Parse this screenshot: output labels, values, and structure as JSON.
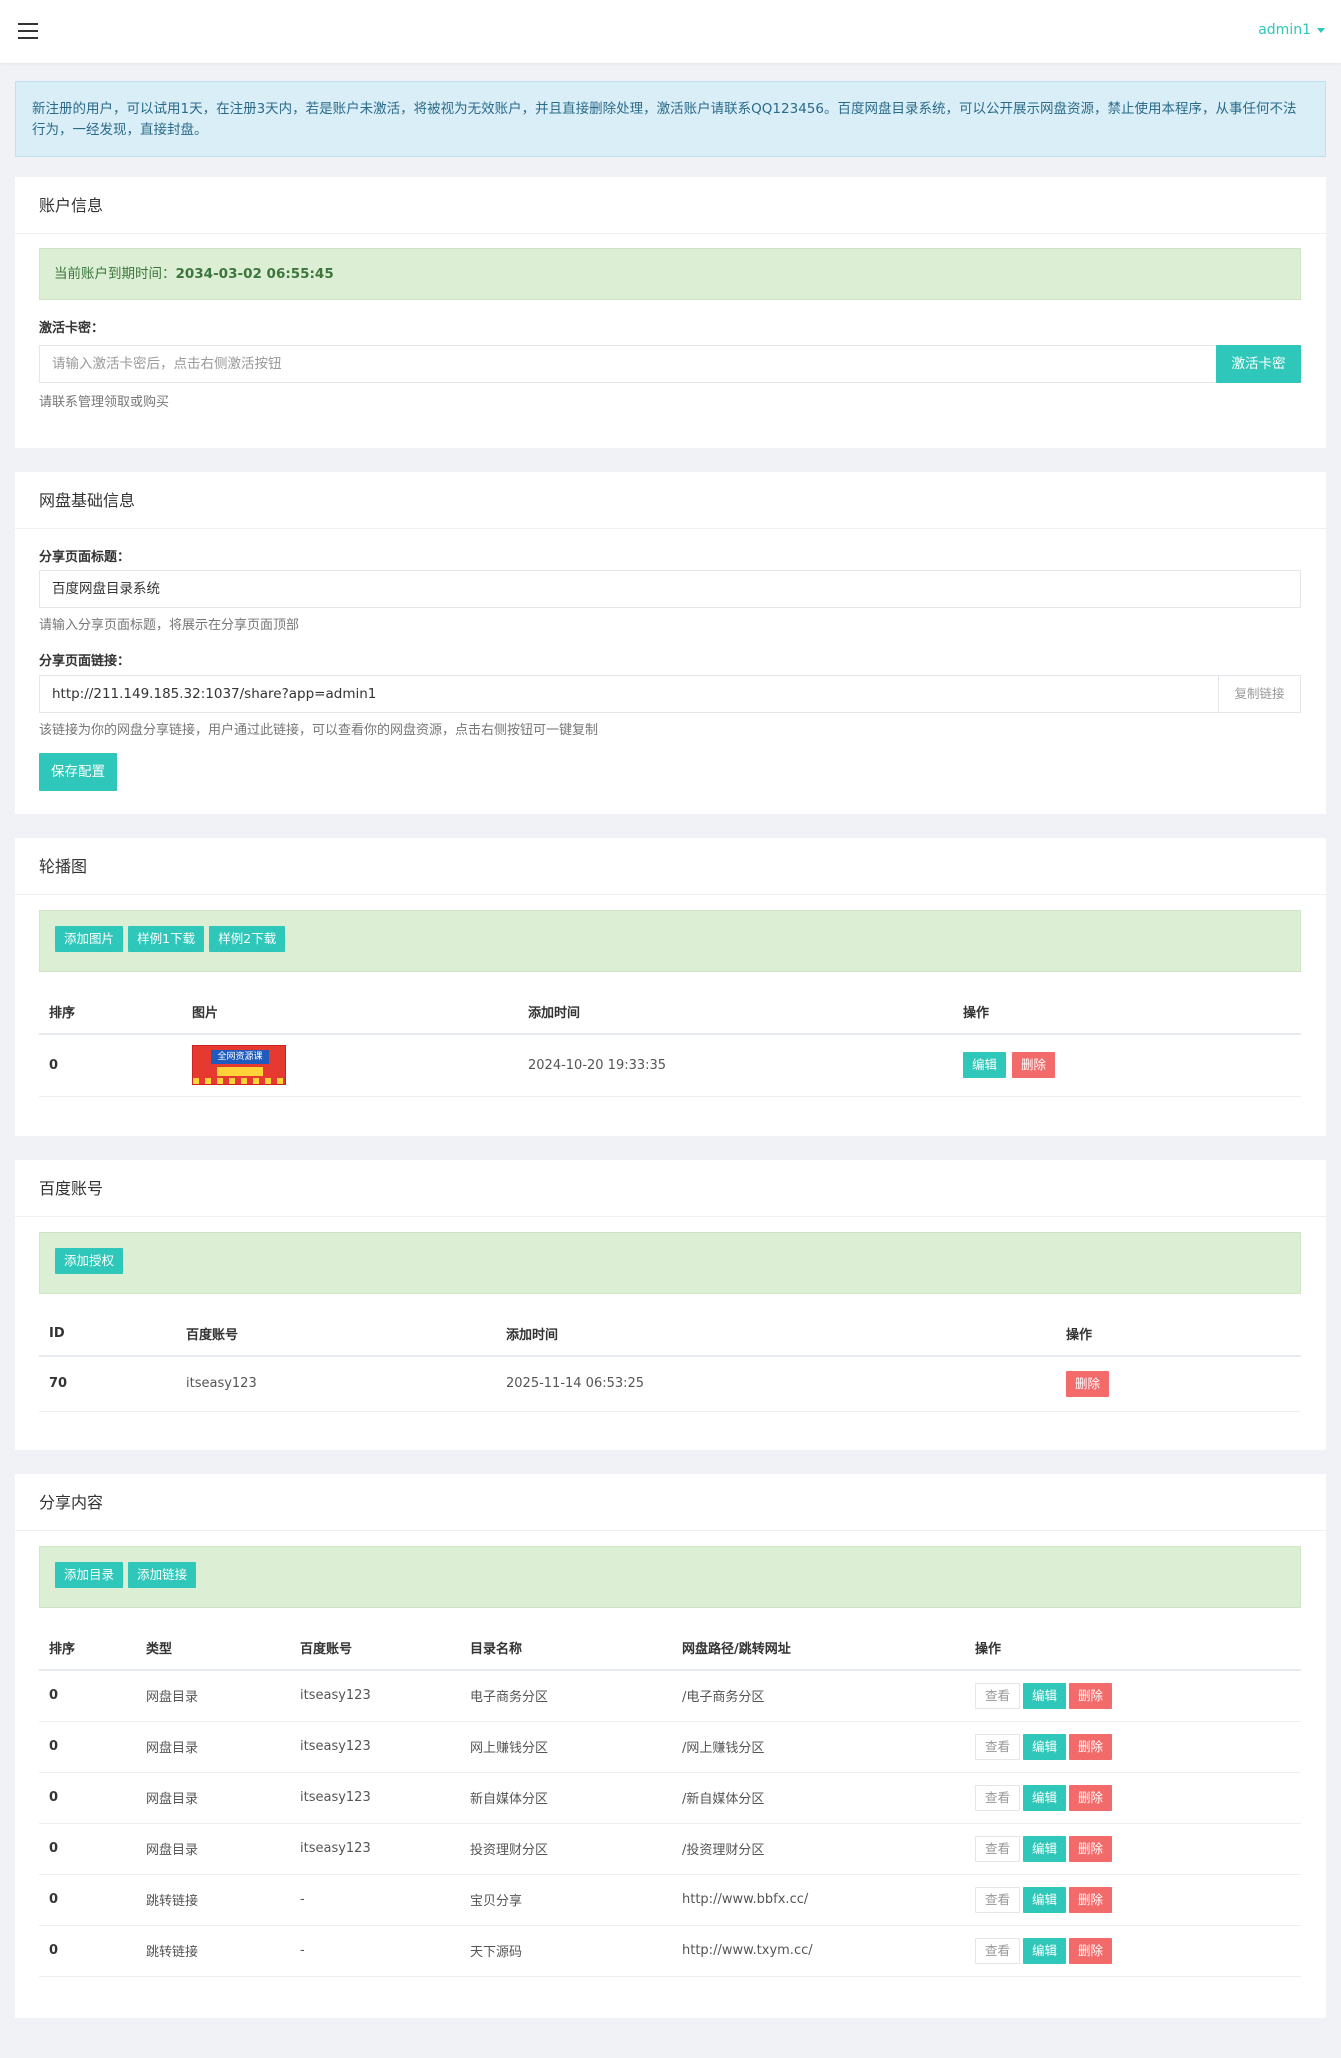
{
  "header": {
    "user": "admin1"
  },
  "notice": "新注册的用户，可以试用1天，在注册3天内，若是账户未激活，将被视为无效账户，并且直接删除处理，激活账户请联系QQ123456。百度网盘目录系统，可以公开展示网盘资源，禁止使用本程序，从事任何不法行为，一经发现，直接封盘。",
  "account": {
    "title": "账户信息",
    "expiry_label": "当前账户到期时间：",
    "expiry_value": "2034-03-02 06:55:45",
    "card_label": "激活卡密：",
    "card_placeholder": "请输入激活卡密后，点击右侧激活按钮",
    "activate_button": "激活卡密",
    "help": "请联系管理领取或购买"
  },
  "basic": {
    "title": "网盘基础信息",
    "share_title_label": "分享页面标题：",
    "share_title_value": "百度网盘目录系统",
    "share_title_help": "请输入分享页面标题，将展示在分享页面顶部",
    "share_link_label": "分享页面链接：",
    "share_link_value": "http://211.149.185.32:1037/share?app=admin1",
    "copy_button": "复制链接",
    "share_link_help": "该链接为你的网盘分享链接，用户通过此链接，可以查看你的网盘资源，点击右侧按钮可一键复制",
    "save_button": "保存配置"
  },
  "carousel": {
    "title": "轮播图",
    "buttons": [
      "添加图片",
      "样例1下载",
      "样例2下载"
    ],
    "columns": [
      "排序",
      "图片",
      "添加时间",
      "操作"
    ],
    "rows": [
      {
        "order": "0",
        "image_text": "全网资源课",
        "time": "2024-10-20 19:33:35",
        "edit": "编辑",
        "delete": "删除"
      }
    ]
  },
  "baidu": {
    "title": "百度账号",
    "add_button": "添加授权",
    "columns": [
      "ID",
      "百度账号",
      "添加时间",
      "操作"
    ],
    "rows": [
      {
        "id": "70",
        "account": "itseasy123",
        "time": "2025-11-14 06:53:25",
        "delete": "删除"
      }
    ]
  },
  "share": {
    "title": "分享内容",
    "buttons": [
      "添加目录",
      "添加链接"
    ],
    "columns": [
      "排序",
      "类型",
      "百度账号",
      "目录名称",
      "网盘路径/跳转网址",
      "操作"
    ],
    "ops": {
      "view": "查看",
      "edit": "编辑",
      "delete": "删除"
    },
    "rows": [
      {
        "order": "0",
        "type": "网盘目录",
        "account": "itseasy123",
        "name": "电子商务分区",
        "path": "/电子商务分区"
      },
      {
        "order": "0",
        "type": "网盘目录",
        "account": "itseasy123",
        "name": "网上赚钱分区",
        "path": "/网上赚钱分区"
      },
      {
        "order": "0",
        "type": "网盘目录",
        "account": "itseasy123",
        "name": "新自媒体分区",
        "path": "/新自媒体分区"
      },
      {
        "order": "0",
        "type": "网盘目录",
        "account": "itseasy123",
        "name": "投资理财分区",
        "path": "/投资理财分区"
      },
      {
        "order": "0",
        "type": "跳转链接",
        "account": "-",
        "name": "宝贝分享",
        "path": "http://www.bbfx.cc/"
      },
      {
        "order": "0",
        "type": "跳转链接",
        "account": "-",
        "name": "天下源码",
        "path": "http://www.txym.cc/"
      }
    ]
  }
}
